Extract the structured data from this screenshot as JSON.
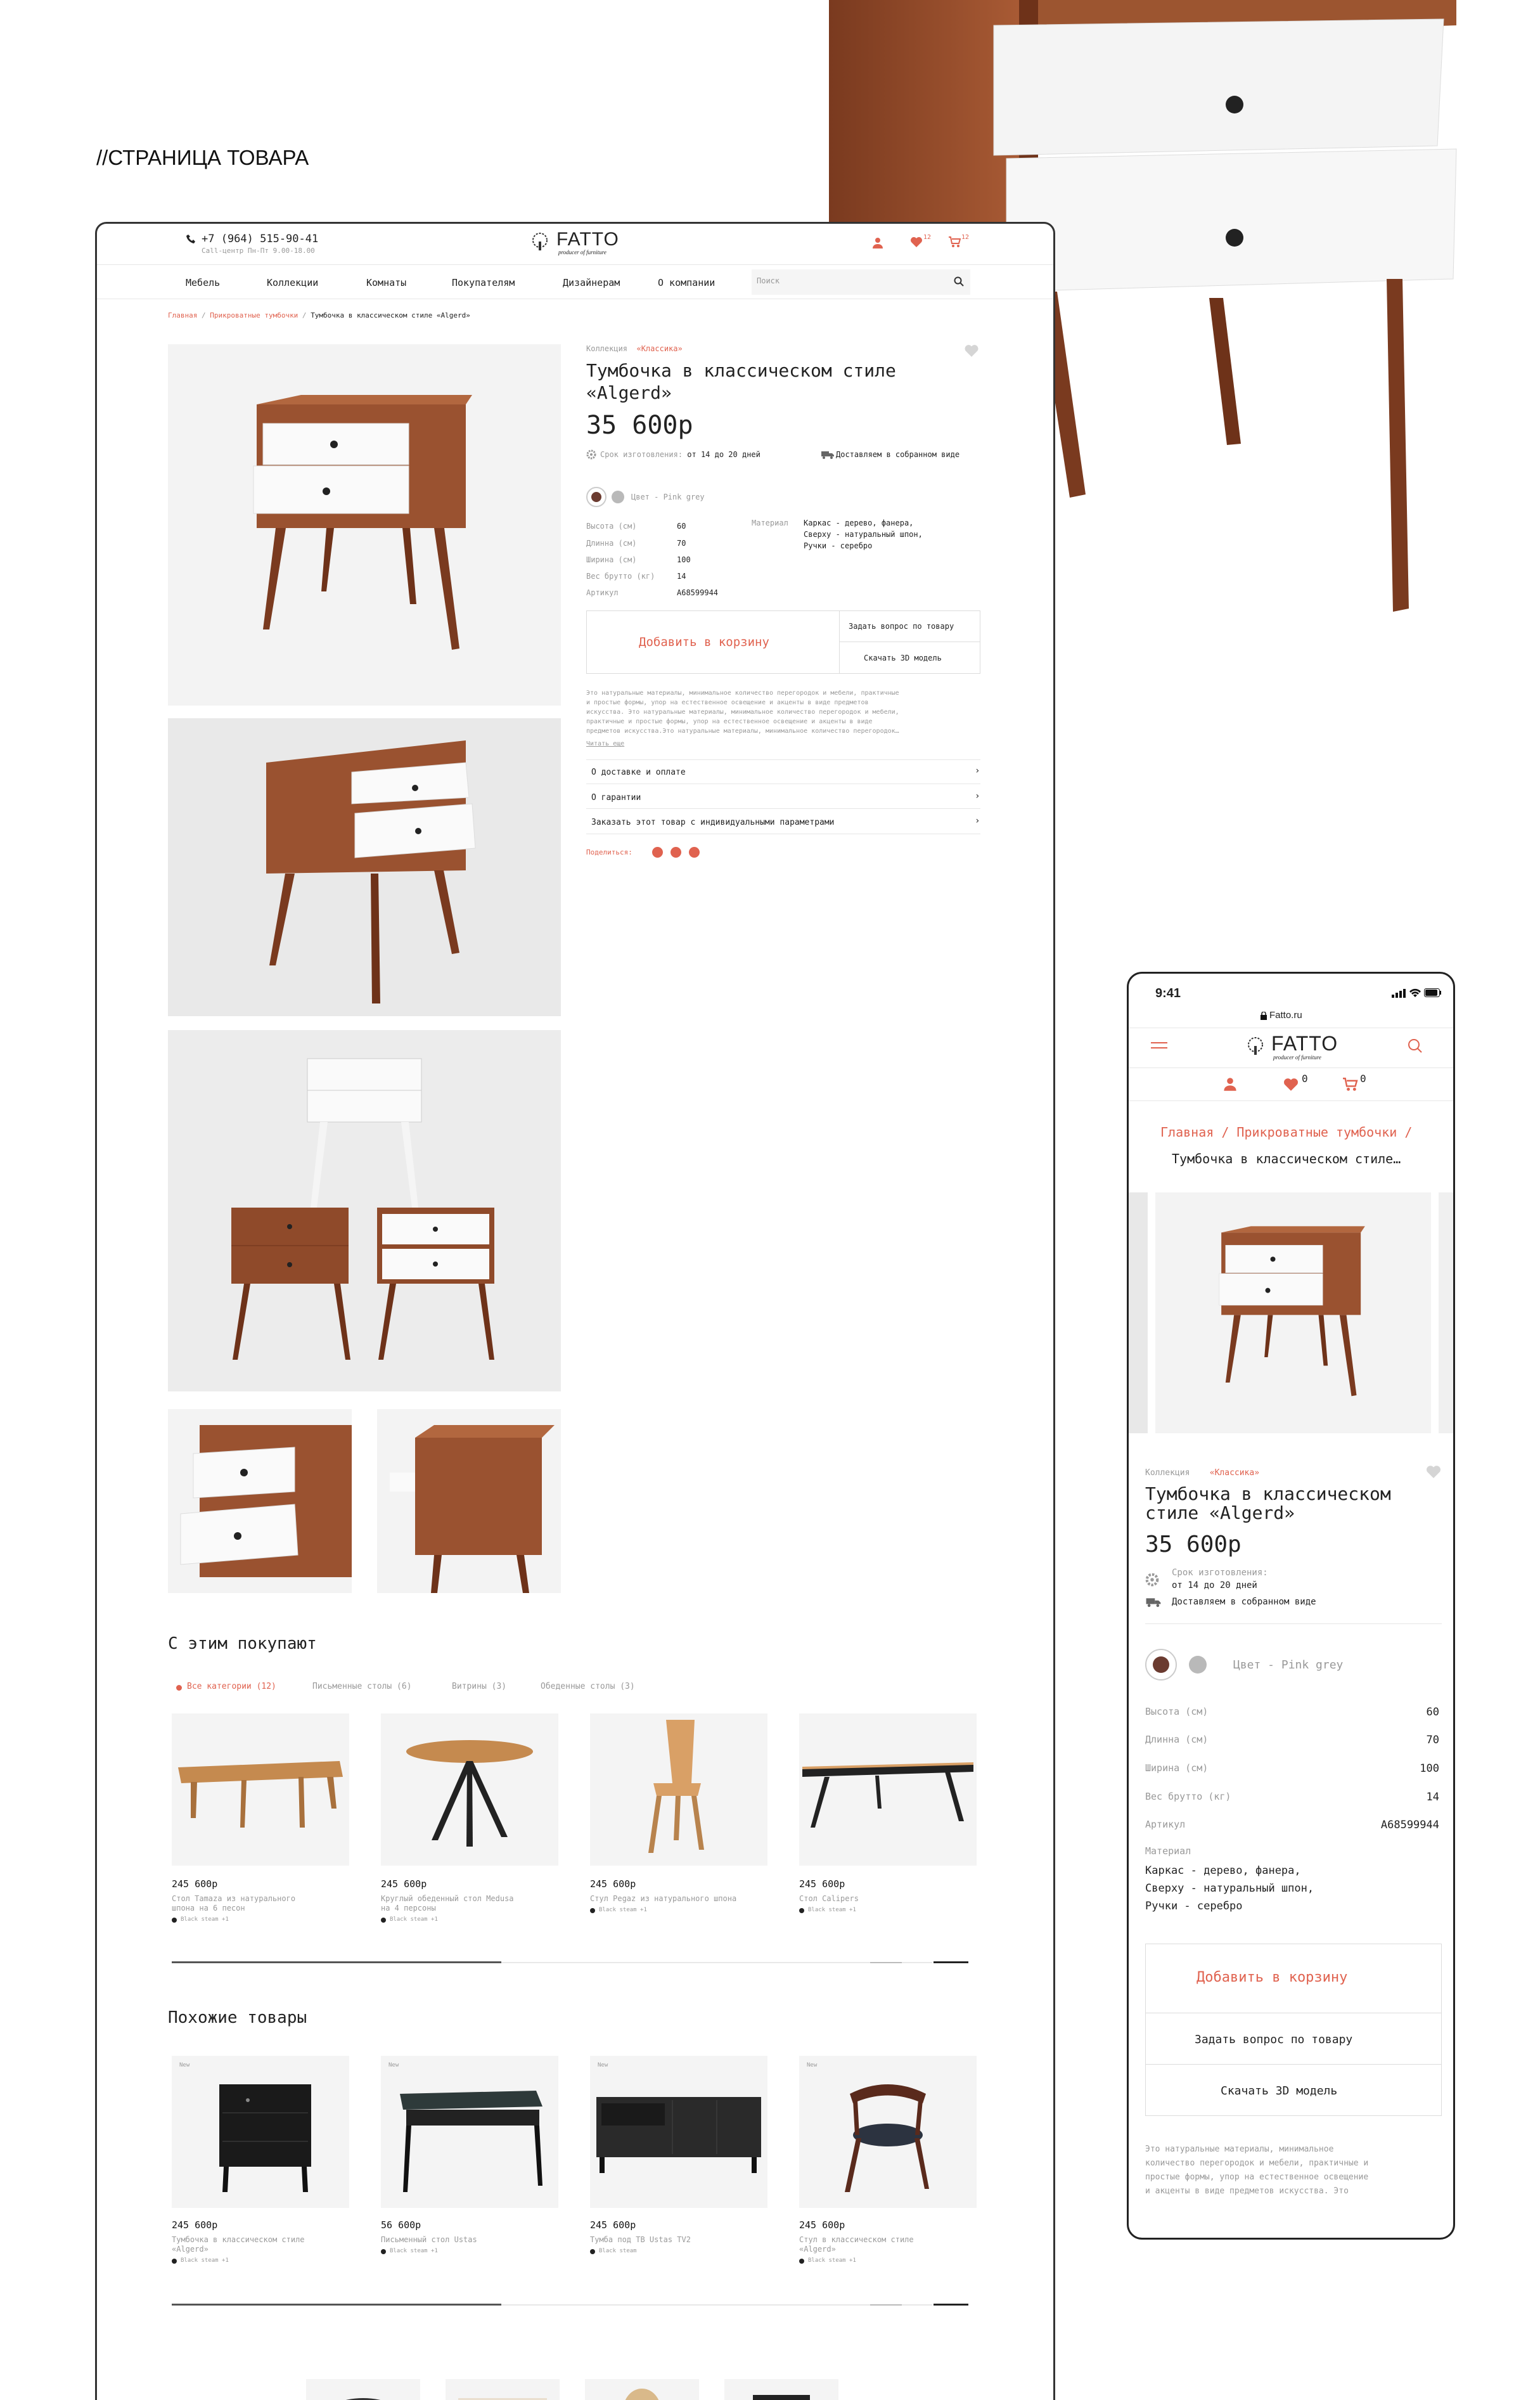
{
  "page_heading": "//СТРАНИЦА ТОВАРА",
  "header": {
    "phone": "+7 (964) 515-90-41",
    "hours": "Call-центр Пн-Пт 9.00-18.00",
    "logo": "FATTO",
    "logo_sub": "producer of furniture",
    "fav_count": "12",
    "cart_count": "12",
    "search_placeholder": "Поиск"
  },
  "nav": [
    "Мебель",
    "Коллекции",
    "Комнаты",
    "Покупателям",
    "Дизайнерам",
    "О компании"
  ],
  "breadcrumb": {
    "home": "Главная",
    "sep": " / ",
    "category": "Прикроватные тумбочки",
    "current": "Тумбочка в классическом стиле «Algerd»"
  },
  "product": {
    "collection_label": "Коллекция",
    "collection": "«Классика»",
    "title_l1": "Тумбочка в классическом стиле",
    "title_l2": "«Algerd»",
    "price": "35 600р",
    "prod_time_label": "Срок изготовления:",
    "prod_time": "от 14 до 20 дней",
    "delivery": "Доставляем в собранном виде",
    "color_label": "Цвет - Pink grey",
    "specs": [
      {
        "k": "Высота (см)",
        "v": "60"
      },
      {
        "k": "Длинна (см)",
        "v": "70"
      },
      {
        "k": "Ширина (см)",
        "v": "100"
      },
      {
        "k": "Вес брутто (кг)",
        "v": "14"
      },
      {
        "k": "Артикул",
        "v": "A68599944"
      }
    ],
    "material_label": "Материал",
    "material_lines": [
      "Каркас - дерево, фанера,",
      "Сверху - натуральный шпон,",
      "Ручки - серебро"
    ],
    "add_to_cart": "Добавить в корзину",
    "ask": "Задать вопрос по товару",
    "download_3d": "Скачать 3D модель",
    "desc_lines": [
      "Это натуральные материалы, минимальное количество перегородок и мебели, практичные",
      "и простые формы, упор на естественное освещение и акценты в виде предметов",
      "искусства. Это натуральные материалы, минимальное количество перегородок и мебели,",
      "практичные и простые формы, упор на естественное освещение и акценты в виде",
      "предметов искусства.Это натуральные материалы, минимальное количество перегородок…"
    ],
    "read_more": "Читать еще",
    "accordions": [
      "О доставке и оплате",
      "О гарантии",
      "Заказать этот товар с индивидуальными параметрами"
    ],
    "share_label": "Поделиться:"
  },
  "also_buy": {
    "title": "С этим покупают",
    "tabs": [
      "Все категории (12)",
      "Письменные столы (6)",
      "Витрины (3)",
      "Обеденные столы (3)"
    ],
    "items": [
      {
        "price": "245 600р",
        "name_l1": "Стол Tamaza из натурального",
        "name_l2": "шпона на 6 песон",
        "meta": "Black steam +1"
      },
      {
        "price": "245 600р",
        "name_l1": "Круглый обеденный стол Medusa",
        "name_l2": "на 4 персоны",
        "meta": "Black steam +1"
      },
      {
        "price": "245 600р",
        "name_l1": "Стул Pegaz из натурального шпона",
        "name_l2": "",
        "meta": "Black steam +1"
      },
      {
        "price": "245 600р",
        "name_l1": "Стол Calipers",
        "name_l2": "",
        "meta": "Black steam +1"
      }
    ]
  },
  "similar": {
    "title": "Похожие товары",
    "badge": "New",
    "items": [
      {
        "price": "245 600р",
        "name_l1": "Тумбочка в классическом стиле",
        "name_l2": "«Algerd»",
        "meta": "Black steam +1"
      },
      {
        "price": "56 600р",
        "name_l1": "Письменный стол Ustas",
        "name_l2": "",
        "meta": "Black steam +1"
      },
      {
        "price": "245 600р",
        "name_l1": "Тумба под ТВ Ustas TV2",
        "name_l2": "",
        "meta": "Black steam"
      },
      {
        "price": "245 600р",
        "name_l1": "Стул в классическом стиле",
        "name_l2": "«Algerd»",
        "meta": "Black steam +1"
      }
    ]
  },
  "mobile": {
    "time": "9:41",
    "url": "Fatto.ru",
    "fav_count": "0",
    "cart_count": "0",
    "bc_l1": "Главная / Прикроватные тумбочки /",
    "bc_l2": "Тумбочка в классическом стиле…",
    "title_l1": "Тумбочка в классическом",
    "title_l2": "стиле «Algerd»",
    "prod_time_label": "Срок изготовления:",
    "material_lines": [
      "Каркас - дерево, фанера,",
      "Сверху - натуральный шпон,",
      "Ручки - серебро"
    ],
    "desc_lines": [
      "Это натуральные материалы, минимальное",
      "количество перегородок и мебели, практичные и",
      "простые формы, упор на естественное освещение",
      "и акценты в виде предметов искусства. Это"
    ]
  },
  "colors": {
    "accent": "#e0624f",
    "wood": "#8b4a2b",
    "swatch1": "#6b3b30",
    "swatch2": "#b9b9b9"
  }
}
